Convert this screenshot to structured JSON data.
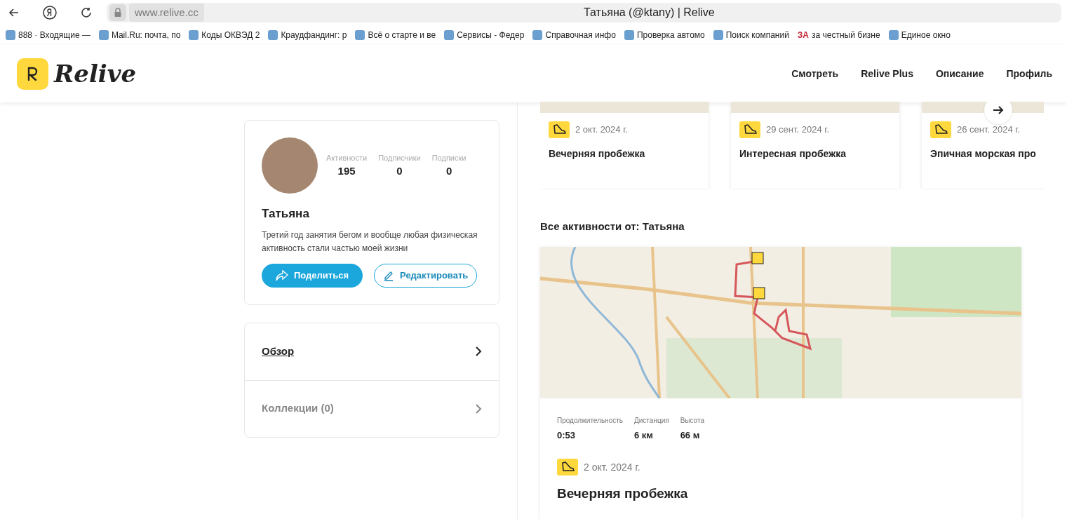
{
  "browser": {
    "address": "www.relive.cc",
    "title": "Татьяна (@ktany) | Relive",
    "bookmarks": [
      {
        "label": "888 · Входящие —"
      },
      {
        "label": "Mail.Ru: почта, по"
      },
      {
        "label": "Коды ОКВЭД 2"
      },
      {
        "label": "Краудфандинг: р"
      },
      {
        "label": "Всё о старте и ве"
      },
      {
        "label": "Сервисы - Федер"
      },
      {
        "label": "Справочная инфо"
      },
      {
        "label": "Проверка автомо"
      },
      {
        "label": "Поиск компаний"
      },
      {
        "label": "за честный бизне",
        "badge": "ЗА"
      },
      {
        "label": "Единое окно"
      }
    ]
  },
  "header": {
    "logo": "Relive",
    "nav": [
      "Смотреть",
      "Relive Plus",
      "Описание",
      "Профиль"
    ]
  },
  "profile": {
    "stats": [
      {
        "label": "Активности",
        "value": "195"
      },
      {
        "label": "Подписчики",
        "value": "0"
      },
      {
        "label": "Подписки",
        "value": "0"
      }
    ],
    "name": "Татьяна",
    "bio": "Третий год занятия бегом и вообще любая физическая активность стали частью моей жизни",
    "share": "Поделиться",
    "edit": "Редактировать"
  },
  "menu": [
    {
      "label": "Обзор",
      "selected": true
    },
    {
      "label": "Коллекции (0)",
      "selected": false
    }
  ],
  "carousel": [
    {
      "date": "2 окт. 2024 г.",
      "title": "Вечерняя пробежка"
    },
    {
      "date": "29 сент. 2024 г.",
      "title": "Интересная пробежка"
    },
    {
      "date": "26 сент. 2024 г.",
      "title": "Эпичная морская про"
    }
  ],
  "all_heading": "Все активности от: Татьяна",
  "activity": {
    "stats": [
      {
        "label": "Продолжительность",
        "value": "0:53"
      },
      {
        "label": "Дистанция",
        "value": "6 км"
      },
      {
        "label": "Высота",
        "value": "66 м"
      }
    ],
    "date": "2 окт. 2024 г.",
    "title": "Вечерняя пробежка"
  }
}
